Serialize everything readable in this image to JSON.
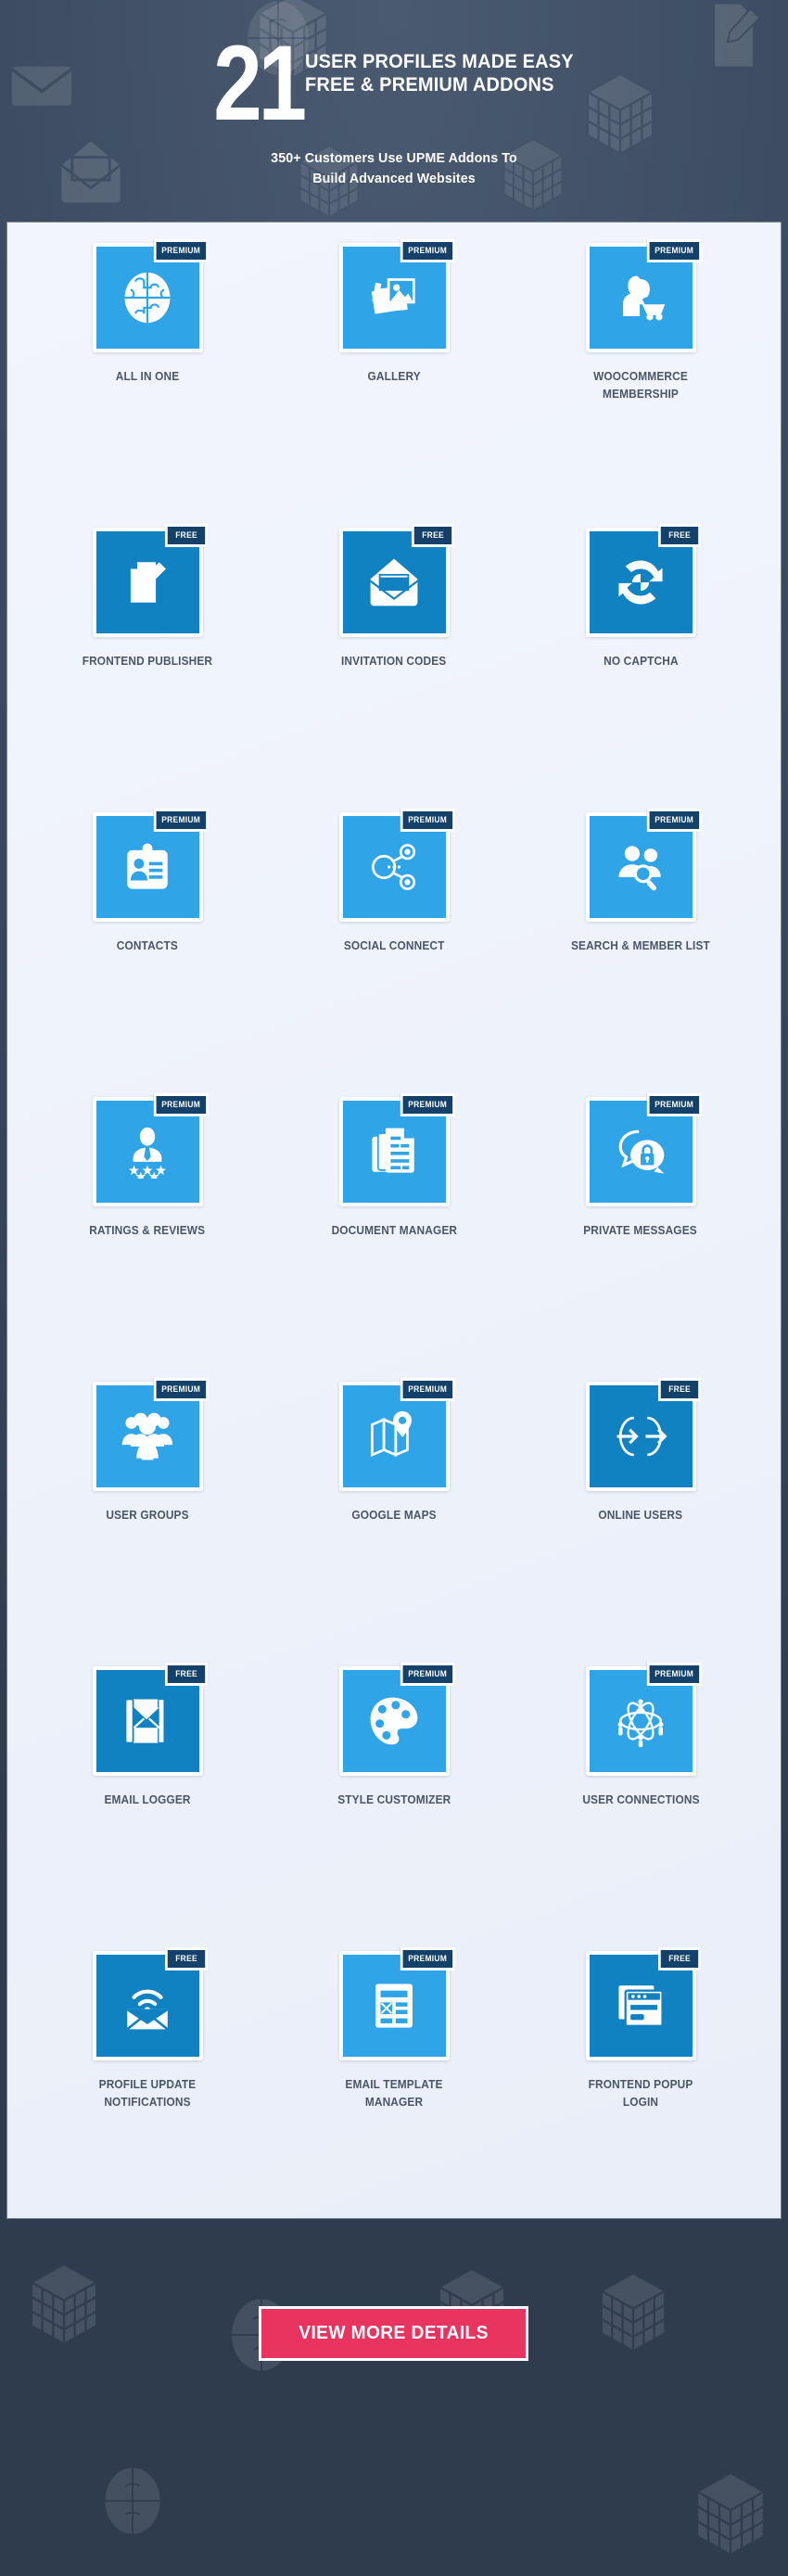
{
  "header": {
    "number": "21",
    "title_line1": "USER PROFILES MADE EASY",
    "title_line2": "FREE & PREMIUM ADDONS",
    "subtitle_line1": "350+ Customers Use UPME Addons To",
    "subtitle_line2": "Build Advanced Websites"
  },
  "colors": {
    "premium_tile": "#2fa5e8",
    "free_tile": "#1082c2",
    "badge": "#134169",
    "cta": "#e8345e",
    "panel": "#eef2fb",
    "caption_text": "#4a5668",
    "background_dark": "#3c4b60"
  },
  "badges": {
    "premium": "PREMIUM",
    "free": "FREE"
  },
  "addons": [
    {
      "label": "ALL IN ONE",
      "badge": "PREMIUM",
      "icon": "puzzle-globe-icon"
    },
    {
      "label": "GALLERY",
      "badge": "PREMIUM",
      "icon": "photo-stack-icon"
    },
    {
      "label": "WOOCOMMERCE MEMBERSHIP",
      "badge": "PREMIUM",
      "icon": "shopper-cart-icon"
    },
    {
      "label": "FRONTEND PUBLISHER",
      "badge": "FREE",
      "icon": "document-pencil-icon"
    },
    {
      "label": "INVITATION CODES",
      "badge": "FREE",
      "icon": "open-envelope-icon"
    },
    {
      "label": "NO CAPTCHA",
      "badge": "FREE",
      "icon": "refresh-captcha-icon"
    },
    {
      "label": "CONTACTS",
      "badge": "PREMIUM",
      "icon": "id-card-icon"
    },
    {
      "label": "SOCIAL CONNECT",
      "badge": "PREMIUM",
      "icon": "share-nodes-icon"
    },
    {
      "label": "SEARCH & MEMBER LIST",
      "badge": "PREMIUM",
      "icon": "users-magnifier-icon"
    },
    {
      "label": "RATINGS & REVIEWS",
      "badge": "PREMIUM",
      "icon": "user-stars-icon"
    },
    {
      "label": "DOCUMENT MANAGER",
      "badge": "PREMIUM",
      "icon": "documents-stack-icon"
    },
    {
      "label": "PRIVATE MESSAGES",
      "badge": "PREMIUM",
      "icon": "chat-lock-icon"
    },
    {
      "label": "USER GROUPS",
      "badge": "PREMIUM",
      "icon": "user-group-icon"
    },
    {
      "label": "GOOGLE MAPS",
      "badge": "PREMIUM",
      "icon": "map-pin-icon"
    },
    {
      "label": "ONLINE USERS",
      "badge": "FREE",
      "icon": "login-logout-arrows-icon"
    },
    {
      "label": "EMAIL LOGGER",
      "badge": "FREE",
      "icon": "mail-book-icon"
    },
    {
      "label": "STYLE CUSTOMIZER",
      "badge": "PREMIUM",
      "icon": "paint-palette-icon"
    },
    {
      "label": "USER CONNECTIONS",
      "badge": "PREMIUM",
      "icon": "atom-users-icon"
    },
    {
      "label": "PROFILE UPDATE NOTIFICATIONS",
      "badge": "FREE",
      "icon": "mail-signal-icon"
    },
    {
      "label": "EMAIL TEMPLATE MANAGER",
      "badge": "PREMIUM",
      "icon": "email-template-icon"
    },
    {
      "label": "FRONTEND POPUP LOGIN",
      "badge": "FREE",
      "icon": "popup-window-icon"
    }
  ],
  "footer": {
    "cta_label": "VIEW MORE DETAILS"
  }
}
